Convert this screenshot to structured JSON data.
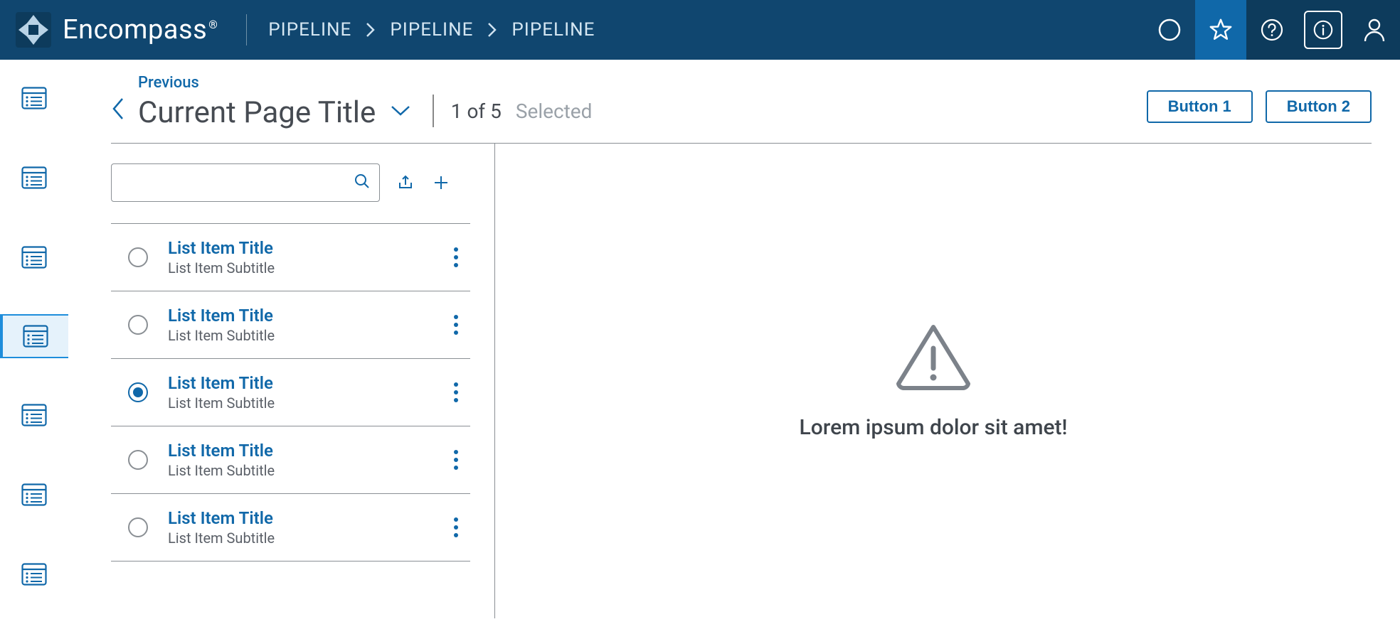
{
  "brand": {
    "name": "Encompass"
  },
  "breadcrumb": [
    "PIPELINE",
    "PIPELINE",
    "PIPELINE"
  ],
  "page": {
    "previous_label": "Previous",
    "title": "Current Page Title",
    "count": "1 of 5",
    "selected_label": "Selected"
  },
  "actions": {
    "button1": "Button 1",
    "button2": "Button 2"
  },
  "search": {
    "placeholder": ""
  },
  "list": [
    {
      "title": "List Item Title",
      "subtitle": "List Item Subtitle",
      "selected": false
    },
    {
      "title": "List Item Title",
      "subtitle": "List Item Subtitle",
      "selected": false
    },
    {
      "title": "List Item Title",
      "subtitle": "List Item Subtitle",
      "selected": true
    },
    {
      "title": "List Item Title",
      "subtitle": "List Item Subtitle",
      "selected": false
    },
    {
      "title": "List Item Title",
      "subtitle": "List Item Subtitle",
      "selected": false
    }
  ],
  "right_pane": {
    "message": "Lorem ipsum dolor sit amet!"
  },
  "rail": {
    "selected_index": 3,
    "count": 7
  }
}
